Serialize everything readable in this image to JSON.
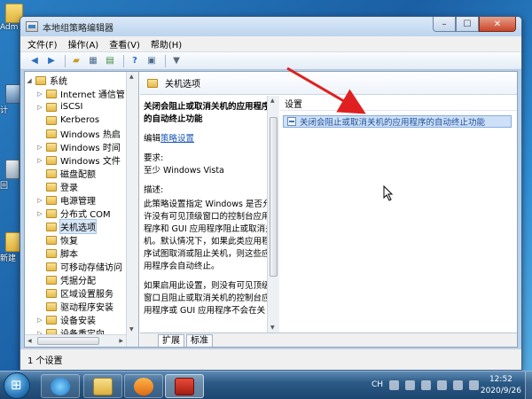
{
  "desktop": {
    "icons": [
      {
        "label": "Adm",
        "icon": "user-folder-icon"
      },
      {
        "label": "计",
        "icon": "computer-icon"
      },
      {
        "label": "回",
        "icon": "recycle-bin-icon"
      },
      {
        "label": "新建",
        "icon": "folder-icon"
      }
    ]
  },
  "window": {
    "title": "本地组策略编辑器",
    "controls": {
      "minimize": "–",
      "maximize": "☐",
      "close": "✕"
    }
  },
  "menubar": [
    "文件(F)",
    "操作(A)",
    "查看(V)",
    "帮助(H)"
  ],
  "toolbar": {
    "icons": [
      "back-icon",
      "forward-icon",
      "up-folder-icon",
      "show-hide-tree-icon",
      "export-list-icon",
      "help-icon",
      "properties-icon",
      "filter-icon"
    ]
  },
  "tree": {
    "items": [
      {
        "label": "系统",
        "expander": "◢",
        "indent": 0
      },
      {
        "label": "Internet 通信管",
        "expander": "▷",
        "indent": 1
      },
      {
        "label": "iSCSI",
        "expander": "▷",
        "indent": 1
      },
      {
        "label": "Kerberos",
        "expander": "",
        "indent": 1
      },
      {
        "label": "Windows 热启",
        "expander": "",
        "indent": 1
      },
      {
        "label": "Windows 时间",
        "expander": "▷",
        "indent": 1
      },
      {
        "label": "Windows 文件",
        "expander": "▷",
        "indent": 1
      },
      {
        "label": "磁盘配额",
        "expander": "",
        "indent": 1
      },
      {
        "label": "登录",
        "expander": "",
        "indent": 1
      },
      {
        "label": "电源管理",
        "expander": "▷",
        "indent": 1
      },
      {
        "label": "分布式 COM",
        "expander": "▷",
        "indent": 1
      },
      {
        "label": "关机选项",
        "expander": "",
        "indent": 1,
        "selected": true
      },
      {
        "label": "恢复",
        "expander": "",
        "indent": 1
      },
      {
        "label": "脚本",
        "expander": "",
        "indent": 1
      },
      {
        "label": "可移动存储访问",
        "expander": "",
        "indent": 1
      },
      {
        "label": "凭据分配",
        "expander": "",
        "indent": 1
      },
      {
        "label": "区域设置服务",
        "expander": "",
        "indent": 1
      },
      {
        "label": "驱动程序安装",
        "expander": "",
        "indent": 1
      },
      {
        "label": "设备安装",
        "expander": "▷",
        "indent": 1
      },
      {
        "label": "设备重定向",
        "expander": "▷",
        "indent": 1
      }
    ]
  },
  "right_pane": {
    "header": "关机选项",
    "description": {
      "title": "关闭会阻止或取消关机的应用程序的自动终止功能",
      "edit_prefix": "编辑",
      "edit_link": "策略设置",
      "requirements_label": "要求:",
      "requirements_value": "至少 Windows Vista",
      "desc_label": "描述:",
      "desc_text": "此策略设置指定 Windows 是否允许没有可见顶级窗口的控制台应用程序和 GUI 应用程序阻止或取消关机。默认情况下，如果此类应用程序试图取消或阻止关机，则这些应用程序会自动终止。",
      "desc_text2": "如果启用此设置，则没有可见顶级窗口且阻止或取消关机的控制台应用程序或 GUI 应用程序不会在关"
    },
    "settings_header": "设置",
    "settings": [
      "关闭会阻止或取消关机的应用程序的自动终止功能"
    ],
    "tabs": [
      "扩展",
      "标准"
    ]
  },
  "statusbar": {
    "text": "1 个设置"
  },
  "taskbar": {
    "apps": [
      "ie-icon",
      "explorer-icon",
      "media-player-icon",
      "group-policy-icon"
    ],
    "tray": {
      "lang": "CH"
    },
    "clock": {
      "time": "12:52",
      "date": "2020/9/26"
    }
  }
}
